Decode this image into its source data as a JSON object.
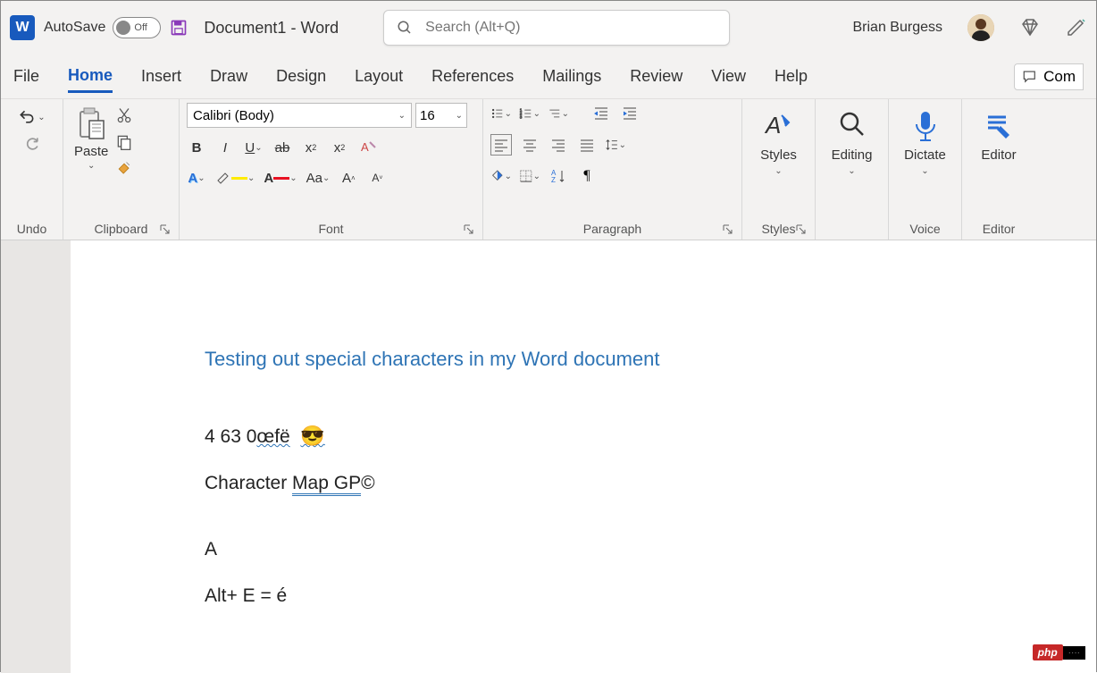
{
  "titlebar": {
    "autosave": "AutoSave",
    "toggle_state": "Off",
    "doc_name": "Document1",
    "separator": " - ",
    "app_name": "Word",
    "search_placeholder": "Search (Alt+Q)",
    "user_name": "Brian Burgess"
  },
  "tabs": {
    "items": [
      "File",
      "Home",
      "Insert",
      "Draw",
      "Design",
      "Layout",
      "References",
      "Mailings",
      "Review",
      "View",
      "Help"
    ],
    "active": "Home",
    "comments": "Com"
  },
  "ribbon": {
    "undo": {
      "label": "Undo"
    },
    "clipboard": {
      "label": "Clipboard",
      "paste": "Paste"
    },
    "font": {
      "label": "Font",
      "font_name": "Calibri (Body)",
      "font_size": "16"
    },
    "paragraph": {
      "label": "Paragraph"
    },
    "styles": {
      "label": "Styles",
      "button": "Styles"
    },
    "editing": {
      "label": "",
      "button": "Editing"
    },
    "voice": {
      "label": "Voice",
      "button": "Dictate"
    },
    "editor": {
      "label": "Editor",
      "button": "Editor"
    }
  },
  "document": {
    "heading": "Testing out special characters in my Word document",
    "line1_a": "4 63   0",
    "line1_b": "œfë",
    "line1_emoji": "😎",
    "line2_a": "Character ",
    "line2_b": "Map",
    "line2_c": "  GP",
    "line2_d": "©",
    "line3": "A",
    "line4": "Alt+ E = é"
  },
  "watermark": {
    "php": "php",
    "cn": "····"
  }
}
